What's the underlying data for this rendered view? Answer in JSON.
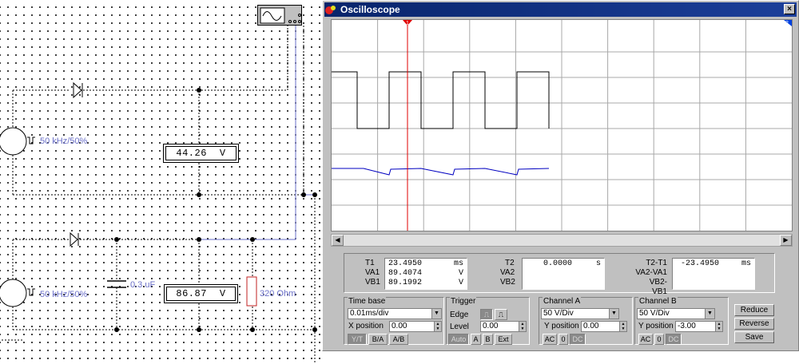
{
  "schematic": {
    "source1_label": "50 kHz/50%",
    "source2_label": "50 kHz/50%",
    "voltmeter1": {
      "value": "44.26",
      "unit": "V"
    },
    "voltmeter2": {
      "value": "86.87",
      "unit": "V"
    },
    "capacitor_label": "0.3 uF",
    "resistor_label": "320  Ohm"
  },
  "window": {
    "title": "Oscilloscope",
    "close_label": "×",
    "cursor1_label": "1",
    "cursor2_label": "2"
  },
  "readout": {
    "t1_label": "T1",
    "t1_value": "23.4950",
    "t1_unit": "ms",
    "va1_label": "VA1",
    "va1_value": "89.4074",
    "va1_unit": "V",
    "vb1_label": "VB1",
    "vb1_value": "89.1992",
    "vb1_unit": "V",
    "t2_label": "T2",
    "t2_value": "0.0000",
    "t2_unit": "s",
    "va2_label": "VA2",
    "vb2_label": "VB2",
    "dt_label": "T2-T1",
    "dt_value": "-23.4950",
    "dt_unit": "ms",
    "dva_label": "VA2-VA1",
    "dvb_label": "VB2-VB1"
  },
  "timebase": {
    "title": "Time base",
    "value": "0.01ms/div",
    "xpos_label": "X position",
    "xpos_value": "0.00",
    "modes": [
      "Y/T",
      "B/A",
      "A/B"
    ]
  },
  "trigger": {
    "title": "Trigger",
    "edge_label": "Edge",
    "level_label": "Level",
    "level_value": "0.00",
    "sources": [
      "Auto",
      "A",
      "B",
      "Ext"
    ]
  },
  "channel_a": {
    "title": "Channel A",
    "value": "50  V/Div",
    "ypos_label": "Y position",
    "ypos_value": "0.00",
    "coupling": [
      "AC",
      "0",
      "DC"
    ]
  },
  "channel_b": {
    "title": "Channel B",
    "value": "50  V/Div",
    "ypos_label": "Y position",
    "ypos_value": "-3.00",
    "coupling": [
      "AC",
      "0",
      "DC"
    ]
  },
  "buttons": {
    "reduce": "Reduce",
    "reverse": "Reverse",
    "save": "Save"
  },
  "colors": {
    "channel_a_trace": "#000000",
    "channel_b_trace": "#0000c0",
    "cursor1": "#e00000",
    "cursor2": "#0040e0",
    "title_bar": "#08246b"
  },
  "icons": [
    "ac-source-icon",
    "diode-icon",
    "capacitor-icon",
    "resistor-icon",
    "oscilloscope-icon",
    "close-icon",
    "scroll-left-icon",
    "scroll-right-icon",
    "edge-rising-icon",
    "edge-falling-icon"
  ]
}
